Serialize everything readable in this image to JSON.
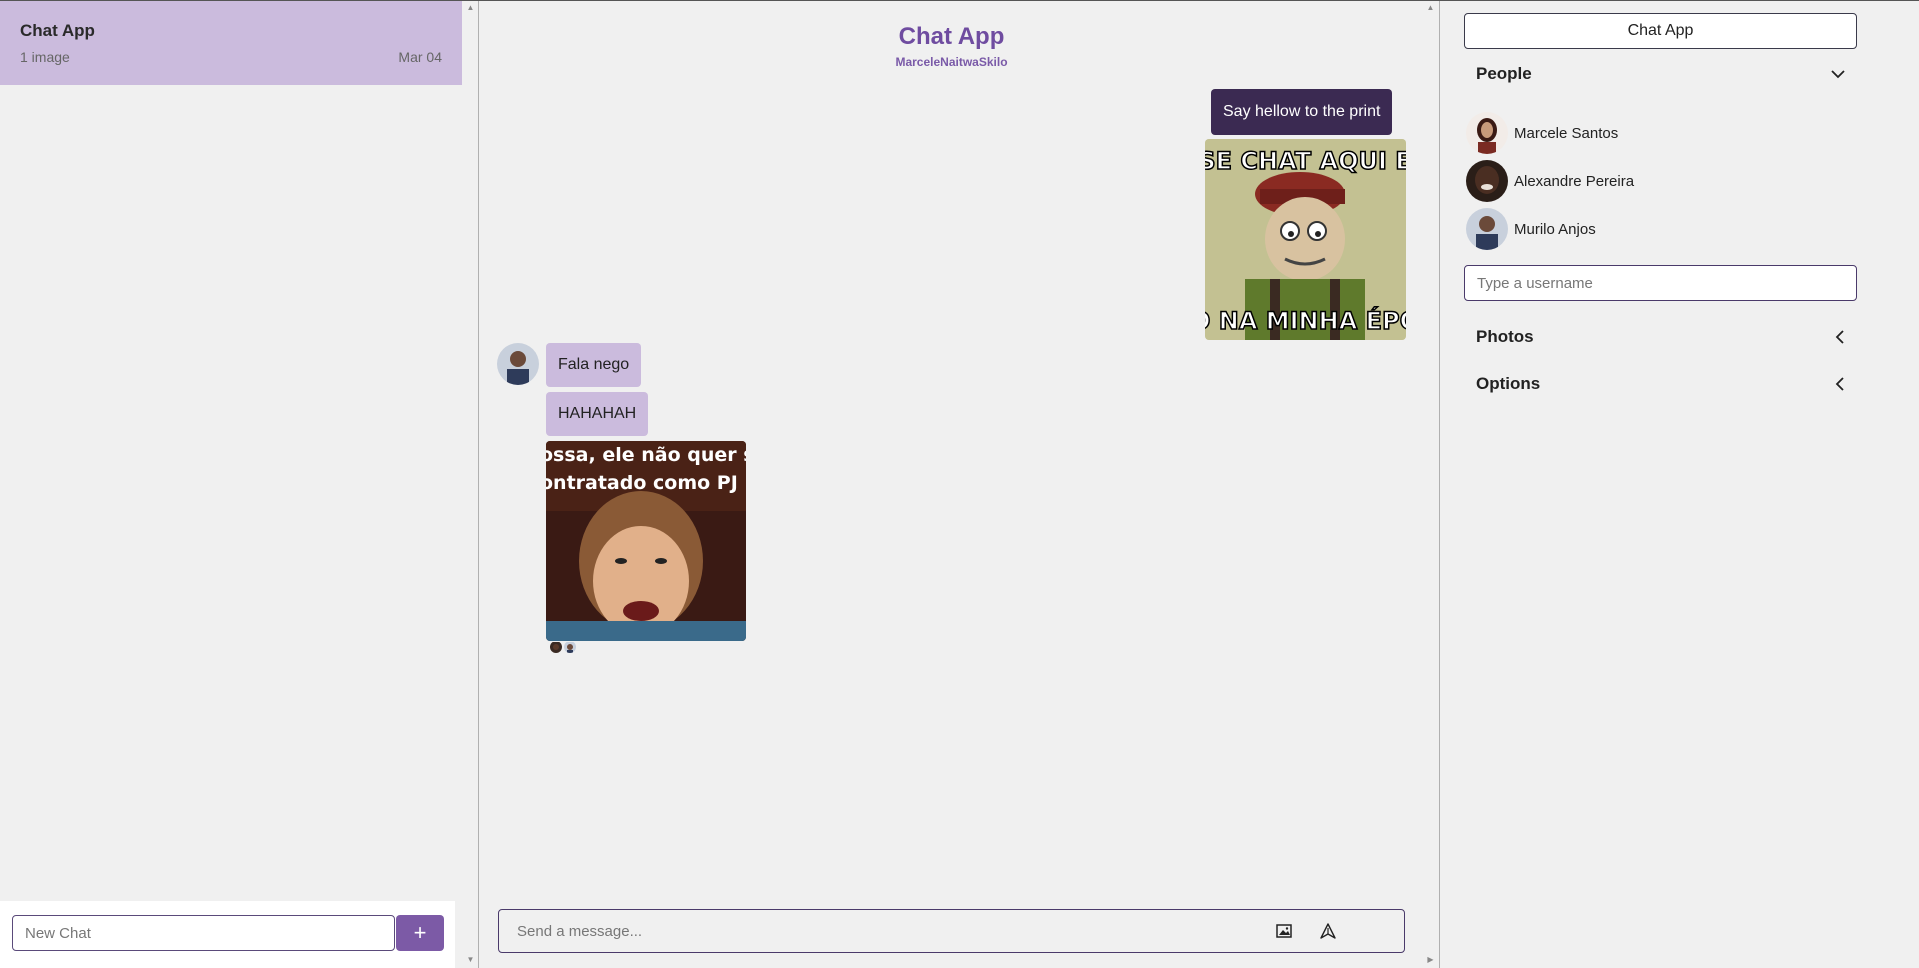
{
  "sidebar": {
    "chats": [
      {
        "title": "Chat App",
        "preview": "1 image",
        "date": "Mar 04"
      }
    ],
    "new_chat_placeholder": "New Chat",
    "add_label": "+"
  },
  "chat": {
    "title": "Chat App",
    "members_line": "MarceleNaitwaSkilo",
    "messages": {
      "out_1": "Say hellow to the print",
      "out_image_caption_top": "SE CHAT AQUI E",
      "out_image_caption_bottom": "O NA MINHA ÉPO",
      "in_1": "Fala nego",
      "in_2": "HAHAHAH",
      "in_image_caption_1": "ossa, ele não quer s",
      "in_image_caption_2": "ontratado como PJ"
    },
    "composer_placeholder": "Send a message..."
  },
  "panel": {
    "top_button": "Chat App",
    "people_label": "People",
    "people": [
      {
        "name": "Marcele Santos",
        "status_color": "#d32f2f"
      },
      {
        "name": "Alexandre Pereira",
        "status_color": "#43a047"
      },
      {
        "name": "Murilo Anjos",
        "status_color": "#d32f2f"
      }
    ],
    "username_placeholder": "Type a username",
    "photos_label": "Photos",
    "options_label": "Options"
  },
  "colors": {
    "accent": "#7c5aa6",
    "selected_chat": "#cbbbdd",
    "outgoing_bubble": "#3b2a52",
    "incoming_bubble": "#cbbbdd"
  }
}
